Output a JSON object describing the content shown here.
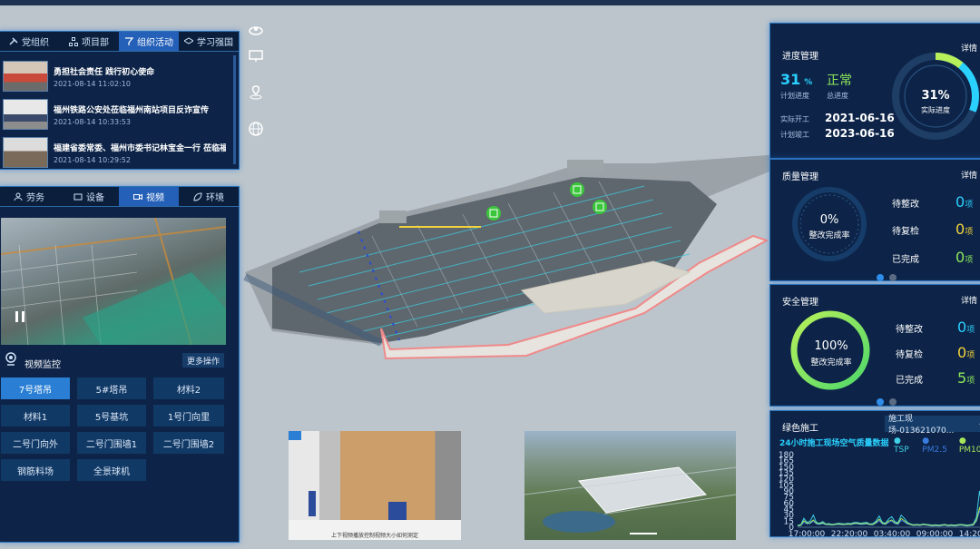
{
  "left_top_tabs": [
    "党组织",
    "项目部",
    "组织活动",
    "学习强国"
  ],
  "news": [
    {
      "title": "勇担社会责任 践行初心使命",
      "date": "2021-08-14 11:02:10"
    },
    {
      "title": "福州铁路公安处莅临福州南站项目反诈宣传",
      "date": "2021-08-14 10:33:53"
    },
    {
      "title": "福建省委常委、福州市委书记林宝金一行 莅临福...",
      "date": "2021-08-14 10:29:52"
    }
  ],
  "left_mid_tabs": [
    "劳务",
    "设备",
    "视频",
    "环境"
  ],
  "video": {
    "section_title": "视频监控",
    "more_label": "更多操作"
  },
  "cameras": [
    "7号塔吊",
    "5#塔吊",
    "材料2",
    "材料1",
    "5号基坑",
    "1号门向里",
    "二号门向外",
    "二号门围墙1",
    "二号门围墙2",
    "钢筋料场",
    "全景球机"
  ],
  "progress": {
    "title": "进度管理",
    "detail": "详情",
    "plan_value": "31",
    "plan_unit": "%",
    "plan_label": "计划进度",
    "status": "正常",
    "status_label": "总进度",
    "ring_value": "31%",
    "ring_label": "实际进度",
    "start_label": "实际开工",
    "start_date": "2021-06-16",
    "end_label": "计划竣工",
    "end_date": "2023-06-16",
    "ring_fraction": 0.31
  },
  "quality": {
    "title": "质量管理",
    "detail": "详情",
    "ring_value": "0%",
    "ring_label": "整改完成率",
    "rows": [
      {
        "label": "待整改",
        "value": "0",
        "unit": "项"
      },
      {
        "label": "待复检",
        "value": "0",
        "unit": "项"
      },
      {
        "label": "已完成",
        "value": "0",
        "unit": "项"
      }
    ]
  },
  "safety": {
    "title": "安全管理",
    "detail": "详情",
    "ring_value": "100%",
    "ring_label": "整改完成率",
    "rows": [
      {
        "label": "待整改",
        "value": "0",
        "unit": "项"
      },
      {
        "label": "待复检",
        "value": "0",
        "unit": "项"
      },
      {
        "label": "已完成",
        "value": "5",
        "unit": "项"
      }
    ]
  },
  "green": {
    "title": "绿色施工",
    "device": "施工现场-013621070...",
    "chart_title": "24小时施工现场空气质量数据"
  },
  "chart_data": {
    "type": "line",
    "title": "24小时施工现场空气质量数据",
    "xlabel": "",
    "ylabel": "",
    "ylim": [
      0,
      180
    ],
    "yticks": [
      0,
      15,
      30,
      45,
      60,
      75,
      90,
      105,
      120,
      135,
      150,
      165,
      180
    ],
    "xticks": [
      "17:00:00",
      "22:20:00",
      "03:40:00",
      "09:00:00",
      "14:20:00"
    ],
    "series": [
      {
        "name": "TSP",
        "color": "#3fd1e8",
        "values": [
          5,
          6,
          22,
          12,
          15,
          30,
          12,
          10,
          14,
          8,
          9,
          7,
          8,
          10,
          9,
          8,
          10,
          9,
          12,
          12,
          10,
          11,
          12,
          8,
          9,
          15,
          28,
          12,
          10,
          20,
          26,
          14,
          11,
          30,
          22,
          12,
          8,
          6,
          7,
          6,
          8,
          7,
          6,
          5,
          6,
          5,
          6,
          7,
          5,
          6,
          5,
          6,
          7,
          6,
          5,
          6,
          8,
          25,
          90,
          40
        ]
      },
      {
        "name": "PM2.5",
        "color": "#3a7be0",
        "values": [
          3,
          4,
          12,
          8,
          9,
          15,
          8,
          7,
          9,
          6,
          6,
          5,
          6,
          7,
          6,
          6,
          7,
          6,
          8,
          8,
          7,
          7,
          8,
          6,
          6,
          10,
          16,
          8,
          7,
          12,
          15,
          9,
          7,
          17,
          13,
          8,
          6,
          4,
          5,
          4,
          6,
          5,
          4,
          3,
          4,
          3,
          4,
          5,
          3,
          4,
          3,
          4,
          5,
          4,
          3,
          4,
          5,
          15,
          40,
          22
        ]
      },
      {
        "name": "PM10",
        "color": "#a6e65a",
        "values": [
          4,
          5,
          16,
          10,
          11,
          18,
          10,
          8,
          11,
          7,
          7,
          6,
          7,
          8,
          7,
          7,
          8,
          7,
          10,
          10,
          8,
          9,
          10,
          7,
          7,
          12,
          20,
          10,
          8,
          15,
          18,
          11,
          9,
          22,
          16,
          10,
          7,
          5,
          6,
          5,
          7,
          6,
          5,
          4,
          5,
          4,
          5,
          6,
          4,
          5,
          4,
          5,
          6,
          5,
          4,
          5,
          6,
          18,
          48,
          26
        ]
      }
    ]
  },
  "video_caption": "上下视频播放控制视频大小如何测定",
  "colors": {
    "accent": "#2e8ee8",
    "good": "#2ad1ff",
    "yellow": "#f4d43a",
    "green": "#8ee85a"
  }
}
